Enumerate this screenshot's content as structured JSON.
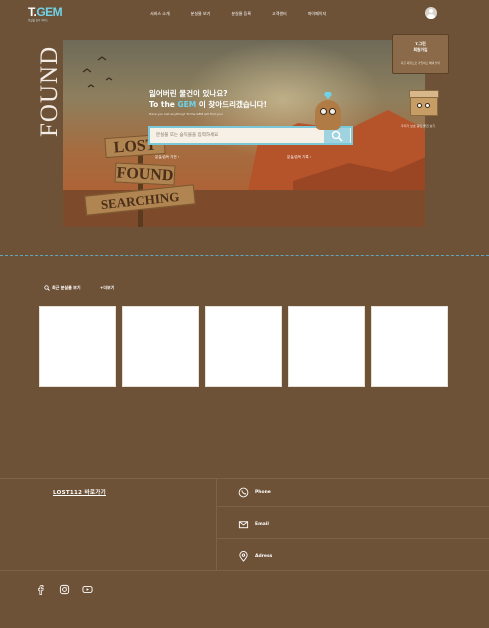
{
  "header": {
    "logo_prefix": "T.",
    "logo_gem": "GEM",
    "logo_sub": "분실물 찾기 서비스",
    "nav": [
      "서비스 소개",
      "분실물 보기",
      "분실물 등록",
      "고객센터",
      "마이페이지"
    ]
  },
  "hero": {
    "side_word": "FOUND",
    "title_line1": "잃어버린 물건이 있나요?",
    "title_line2_a": "To the ",
    "title_line2_gem": "GEM",
    "title_line2_b": " 이 찾아드리겠습니다!",
    "subtitle": "Have you lost anything? To the GEM will find you!",
    "search_placeholder": "분실물 또는 습득물을 입력하세요",
    "link_left": "분실/습득 가전 ›",
    "link_right": "분실/습득 기록 ›",
    "signs": [
      "LOST",
      "FOUND",
      "SEARCHING"
    ]
  },
  "side_panel": {
    "card_line1": "T.그린",
    "card_line2": "회원가입",
    "card_sub": "지금 회원으로 가입하고 혜택 받기",
    "caption": "우리가 보호 중인 물건 보기"
  },
  "recent": {
    "title": "최근 분실물 보기",
    "more": "+더보기",
    "cards": [
      "",
      "",
      "",
      "",
      ""
    ]
  },
  "footer": {
    "lost112": "LOST112 바로가기",
    "phone_label": "Phone",
    "email_label": "Email",
    "address_label": "Adress"
  },
  "colors": {
    "background": "#6e5238",
    "accent": "#6fd3e8",
    "divider": "#5fa6c0"
  }
}
